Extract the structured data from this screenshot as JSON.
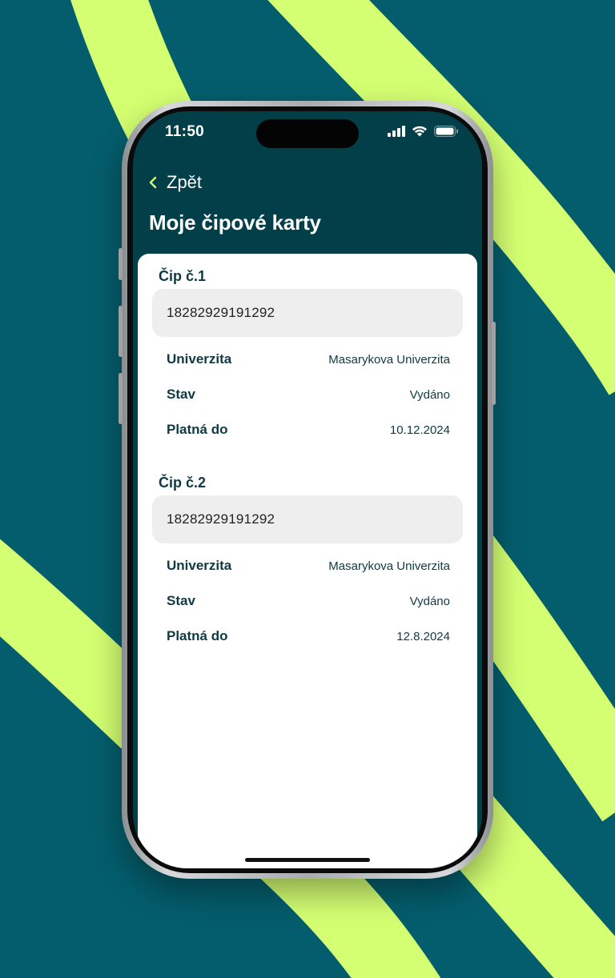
{
  "status_bar": {
    "time": "11:50",
    "icons": [
      "cellular-signal-icon",
      "wifi-icon",
      "battery-icon"
    ]
  },
  "header": {
    "back_label": "Zpět",
    "title": "Moje čipové karty"
  },
  "chips": [
    {
      "heading": "Čip č.1",
      "number": "18282929191292",
      "details": [
        {
          "label": "Univerzita",
          "value": "Masarykova Univerzita"
        },
        {
          "label": "Stav",
          "value": "Vydáno"
        },
        {
          "label": "Platná do",
          "value": "10.12.2024"
        }
      ]
    },
    {
      "heading": "Čip č.2",
      "number": "18282929191292",
      "details": [
        {
          "label": "Univerzita",
          "value": "Masarykova Univerzita"
        },
        {
          "label": "Stav",
          "value": "Vydáno"
        },
        {
          "label": "Platná do",
          "value": "12.8.2024"
        }
      ]
    }
  ],
  "colors": {
    "background": "#045d6c",
    "accent_lime": "#d4ff72",
    "header_bg": "#023f49",
    "text_dark": "#0d3a44",
    "field_bg": "#eeeeee"
  }
}
